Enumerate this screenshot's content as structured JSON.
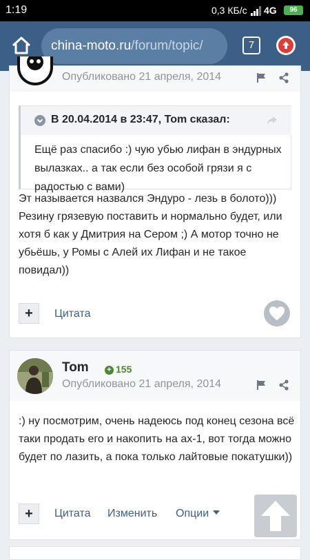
{
  "status_bar": {
    "time": "1:19",
    "speed": "0,3 КБ/с",
    "network": "4G",
    "battery": "96"
  },
  "browser": {
    "url_host": "china-moto.ru",
    "url_path": "/forum/topic/",
    "tabs_count": "7"
  },
  "post1": {
    "posted": "Опубликовано 21 апреля, 2014",
    "quote_title": "В 20.04.2014 в 23:47, Tom сказал:",
    "quote_text": "Ещё раз спасибо :) чую убью лифан в эндурных вылазках.. а так если без особой грязи я с радостью с вами)",
    "text": "Эт называется назвался Эндуро - лезь в болото))) Резину грязевую поставить и нормально будет, или хотя б как у Дмитрия на Сером ;) А мотор точно не убьёшь, у Ромы с Алей их Лифан и не такое повидал))",
    "actions": {
      "plus": "+",
      "quote": "Цитата"
    }
  },
  "post2": {
    "author": "Tom",
    "reputation": "155",
    "posted": "Опубликовано 21 апреля, 2014",
    "text": ":) ну посмотрим, очень надеюсь под конец сезона всё таки продать его и накопить на ах-1, вот тогда можно будет по лазить, а пока только лайтовые покатушки))",
    "actions": {
      "plus": "+",
      "quote": "Цитата",
      "edit": "Изменить",
      "options": "Опции"
    }
  },
  "colors": {
    "header": "#3b5f86",
    "link": "#3b5f86",
    "reputation": "#4a8a32"
  }
}
